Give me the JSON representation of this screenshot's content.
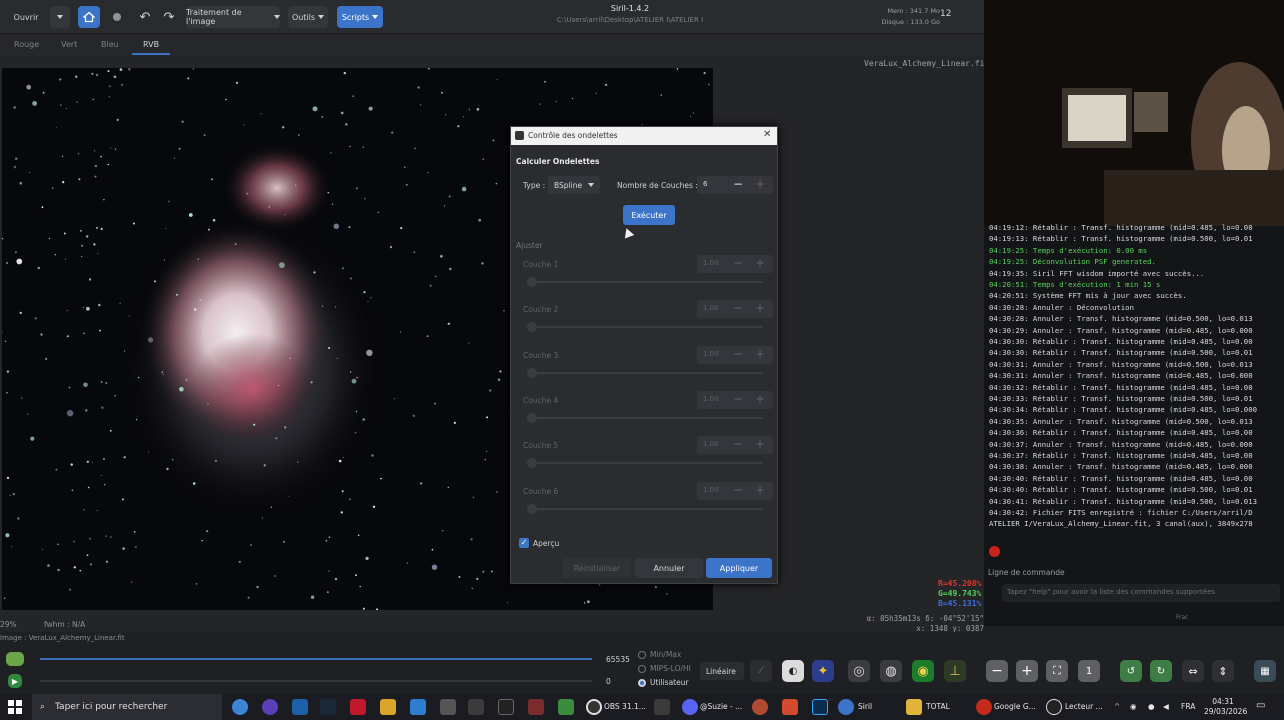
{
  "header": {
    "open_label": "Ouvrir",
    "processing_label": "Traitement de l'image",
    "tools_label": "Outils",
    "scripts_label": "Scripts",
    "app_title": "Siril-1.4.2",
    "file_path": "C:\\Users\\arril\\Desktop\\ATELIER I\\ATELIER I",
    "mem_label": "Mem : 341.7 Mo",
    "disk_label": "Disque : 133.0 Go",
    "threads": "12"
  },
  "tabs": [
    "Rouge",
    "Vert",
    "Bleu",
    "RVB"
  ],
  "active_tab": "RVB",
  "image_filename": "VeraLux_Alchemy_Linear.fit",
  "status": {
    "zoom": "29%",
    "fwhm": "fwhm : N/A",
    "image_label": "Image : VeraLux_Alchemy_Linear.fit",
    "coords_1": "α: 05h35m13s δ: -04°52'15\"",
    "coords_2": "x: 1348 y: 0387",
    "r_stat": "R=45.208%",
    "g_stat": "G=49.743%",
    "b_stat": "B=45.131%"
  },
  "dialog": {
    "title": "Contrôle des ondelettes",
    "section_compute": "Calculer Ondelettes",
    "type_label": "Type :",
    "type_value": "BSpline",
    "layers_label": "Nombre de Couches :",
    "layers_value": "6",
    "execute_label": "Exécuter",
    "adjust_label": "Ajuster",
    "layers": [
      {
        "label": "Couche 1",
        "value": "1.00"
      },
      {
        "label": "Couche 2",
        "value": "1.00"
      },
      {
        "label": "Couche 3",
        "value": "1.00"
      },
      {
        "label": "Couche 4",
        "value": "1.00"
      },
      {
        "label": "Couche 5",
        "value": "1.00"
      },
      {
        "label": "Couche 6",
        "value": "1.00"
      }
    ],
    "preview_label": "Aperçu",
    "reset_label": "Réinitialiser",
    "cancel_label": "Annuler",
    "apply_label": "Appliquer"
  },
  "console": [
    {
      "text": "04:19:12: Rétablir : Transf. histogramme (mid=0.485, lo=0.00",
      "green": false
    },
    {
      "text": "04:19:13: Rétablir : Transf. histogramme (mid=0.500, lo=0.01",
      "green": false
    },
    {
      "text": "04:19:25: Temps d'exécution: 0.00 ms",
      "green": true
    },
    {
      "text": "04:19:25: Déconvolution PSF generated.",
      "green": true
    },
    {
      "text": "04:19:35: Siril FFT wisdom importé avec succès...",
      "green": false
    },
    {
      "text": "04:20:51: Temps d'exécution: 1 min 15 s",
      "green": true
    },
    {
      "text": "04:20:51: Système FFT mis à jour avec succès.",
      "green": false
    },
    {
      "text": "04:30:28: Annuler : Déconvolution",
      "green": false
    },
    {
      "text": "04:30:28: Annuler : Transf. histogramme (mid=0.500, lo=0.013",
      "green": false
    },
    {
      "text": "04:30:29: Annuler : Transf. histogramme (mid=0.485, lo=0.000",
      "green": false
    },
    {
      "text": "04:30:30: Rétablir : Transf. histogramme (mid=0.485, lo=0.00",
      "green": false
    },
    {
      "text": "04:30:30: Rétablir : Transf. histogramme (mid=0.500, lo=0.01",
      "green": false
    },
    {
      "text": "04:30:31: Annuler : Transf. histogramme (mid=0.500, lo=0.013",
      "green": false
    },
    {
      "text": "04:30:31: Annuler : Transf. histogramme (mid=0.485, lo=0.000",
      "green": false
    },
    {
      "text": "04:30:32: Rétablir : Transf. histogramme (mid=0.485, lo=0.00",
      "green": false
    },
    {
      "text": "04:30:33: Rétablir : Transf. histogramme (mid=0.500, lo=0.01",
      "green": false
    },
    {
      "text": "04:30:34: Rétablir : Transf. histogramme (mid=0.485, lo=0.000",
      "green": false
    },
    {
      "text": "04:30:35: Annuler : Transf. histogramme (mid=0.500, lo=0.013",
      "green": false
    },
    {
      "text": "04:30:36: Rétablir : Transf. histogramme (mid=0.485, lo=0.00",
      "green": false
    },
    {
      "text": "04:30:37: Annuler : Transf. histogramme (mid=0.485, lo=0.000",
      "green": false
    },
    {
      "text": "04:30:37: Rétablir : Transf. histogramme (mid=0.485, lo=0.00",
      "green": false
    },
    {
      "text": "04:30:38: Annuler : Transf. histogramme (mid=0.485, lo=0.000",
      "green": false
    },
    {
      "text": "04:30:40: Rétablir : Transf. histogramme (mid=0.485, lo=0.00",
      "green": false
    },
    {
      "text": "04:30:40: Rétablir : Transf. histogramme (mid=0.500, lo=0.01",
      "green": false
    },
    {
      "text": "04:30:41: Rétablir : Transf. histogramme (mid=0.500, lo=0.013",
      "green": false
    },
    {
      "text": "04:30:42: Fichier FITS enregistré : fichier C:/Users/arril/D",
      "green": false
    },
    {
      "text": "ATELIER I/VeraLux_Alchemy_Linear.fit, 3 canal(aux), 3849x278",
      "green": false
    }
  ],
  "command": {
    "label": "Ligne de commande",
    "placeholder": "Tapez \"help\" pour avoir la liste des commandes supportées",
    "mini": "Frac"
  },
  "bottom": {
    "max_value": "65535",
    "min_value": "0",
    "radio_minmax": "Min/Max",
    "radio_mipslohi": "MIPS-LO/HI",
    "radio_user": "Utilisateur",
    "stretch_mode": "Linéaire"
  },
  "taskbar": {
    "search_placeholder": "Taper ici pour rechercher",
    "obs_label": "OBS 31.1...",
    "discord_label": "@Suzie - ...",
    "siril_label": "Siril",
    "total_label": "TOTAL",
    "google_label": "Google G...",
    "player_label": "Lecteur ...",
    "lang": "FRA",
    "time": "04:31",
    "date": "29/03/2026"
  }
}
